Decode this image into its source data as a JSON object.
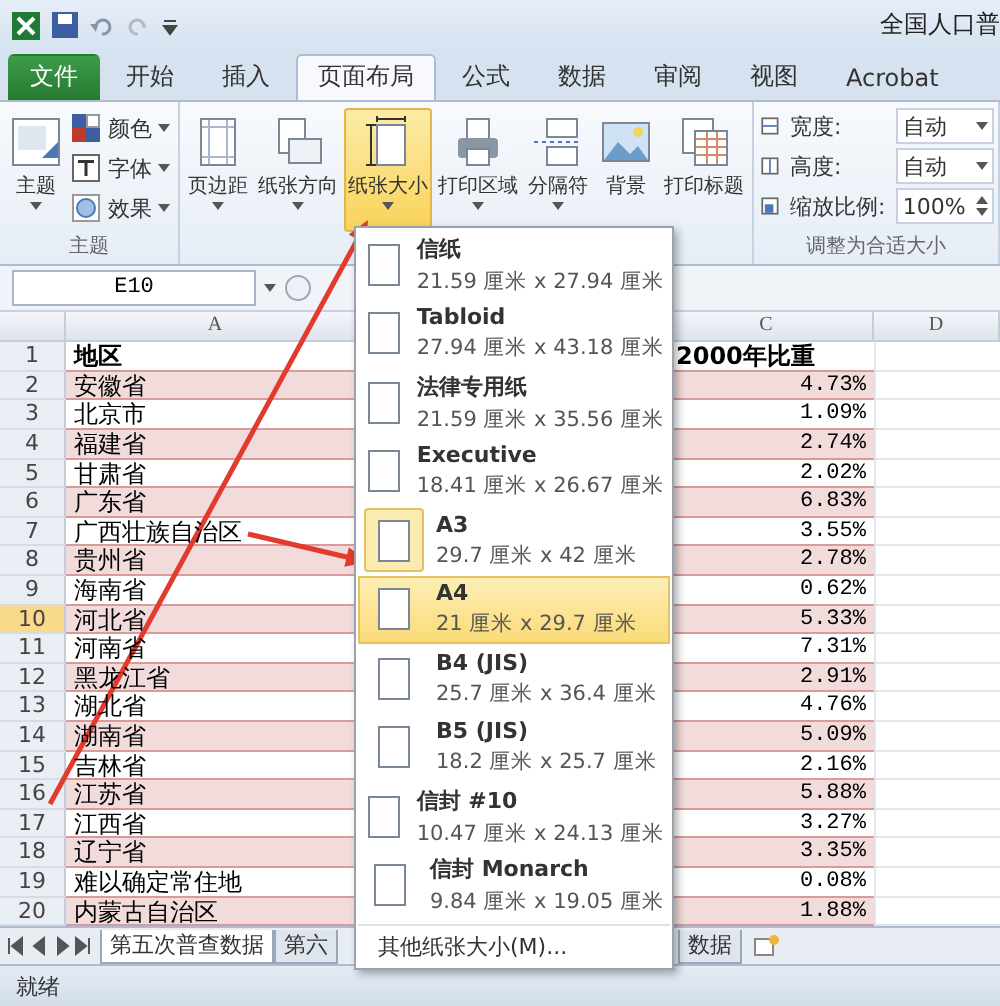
{
  "title_bar": {
    "title": "全国人口普"
  },
  "tabs": [
    {
      "label": "文件",
      "kind": "file",
      "selected": false
    },
    {
      "label": "开始",
      "kind": "tab",
      "selected": false
    },
    {
      "label": "插入",
      "kind": "tab",
      "selected": false
    },
    {
      "label": "页面布局",
      "kind": "tab",
      "selected": true
    },
    {
      "label": "公式",
      "kind": "tab",
      "selected": false
    },
    {
      "label": "数据",
      "kind": "tab",
      "selected": false
    },
    {
      "label": "审阅",
      "kind": "tab",
      "selected": false
    },
    {
      "label": "视图",
      "kind": "tab",
      "selected": false
    },
    {
      "label": "Acrobat",
      "kind": "tab",
      "selected": false
    }
  ],
  "ribbon": {
    "theme_group": {
      "label": "主题",
      "main": "主题",
      "items": [
        "颜色",
        "字体",
        "效果"
      ]
    },
    "page_setup": {
      "buttons": [
        {
          "label": "页边距",
          "caret": true,
          "highlighted": false
        },
        {
          "label": "纸张方向",
          "caret": true,
          "highlighted": false
        },
        {
          "label": "纸张大小",
          "caret": true,
          "highlighted": true
        },
        {
          "label": "打印区域",
          "caret": true,
          "highlighted": false
        },
        {
          "label": "分隔符",
          "caret": true,
          "highlighted": false
        },
        {
          "label": "背景",
          "caret": false,
          "highlighted": false
        },
        {
          "label": "打印标题",
          "caret": false,
          "highlighted": false
        }
      ]
    },
    "scale_group": {
      "label": "调整为合适大小",
      "fields": [
        {
          "label": "宽度:",
          "value": "自动",
          "kind": "dropdown"
        },
        {
          "label": "高度:",
          "value": "自动",
          "kind": "dropdown"
        },
        {
          "label": "缩放比例:",
          "value": "100%",
          "kind": "spinner"
        }
      ]
    }
  },
  "name_box": "E10",
  "columns": [
    {
      "label": "A",
      "selected": false
    },
    {
      "label": "C",
      "selected": false
    },
    {
      "label": "D",
      "selected": false
    }
  ],
  "header_row": {
    "number": "1",
    "region": "地区",
    "share": "2000年比重"
  },
  "rows": [
    {
      "number": "2",
      "region": "安徽省",
      "share": "4.73%",
      "shaded": true,
      "selected": false
    },
    {
      "number": "3",
      "region": "北京市",
      "share": "1.09%",
      "shaded": false,
      "selected": false
    },
    {
      "number": "4",
      "region": "福建省",
      "share": "2.74%",
      "shaded": true,
      "selected": false
    },
    {
      "number": "5",
      "region": "甘肃省",
      "share": "2.02%",
      "shaded": false,
      "selected": false
    },
    {
      "number": "6",
      "region": "广东省",
      "share": "6.83%",
      "shaded": true,
      "selected": false
    },
    {
      "number": "7",
      "region": "广西壮族自治区",
      "share": "3.55%",
      "shaded": false,
      "selected": false
    },
    {
      "number": "8",
      "region": "贵州省",
      "share": "2.78%",
      "shaded": true,
      "selected": false
    },
    {
      "number": "9",
      "region": "海南省",
      "share": "0.62%",
      "shaded": false,
      "selected": false
    },
    {
      "number": "10",
      "region": "河北省",
      "share": "5.33%",
      "shaded": true,
      "selected": true
    },
    {
      "number": "11",
      "region": "河南省",
      "share": "7.31%",
      "shaded": false,
      "selected": false
    },
    {
      "number": "12",
      "region": "黑龙江省",
      "share": "2.91%",
      "shaded": true,
      "selected": false
    },
    {
      "number": "13",
      "region": "湖北省",
      "share": "4.76%",
      "shaded": false,
      "selected": false
    },
    {
      "number": "14",
      "region": "湖南省",
      "share": "5.09%",
      "shaded": true,
      "selected": false
    },
    {
      "number": "15",
      "region": "吉林省",
      "share": "2.16%",
      "shaded": false,
      "selected": false
    },
    {
      "number": "16",
      "region": "江苏省",
      "share": "5.88%",
      "shaded": true,
      "selected": false
    },
    {
      "number": "17",
      "region": "江西省",
      "share": "3.27%",
      "shaded": false,
      "selected": false
    },
    {
      "number": "18",
      "region": "辽宁省",
      "share": "3.35%",
      "shaded": true,
      "selected": false
    },
    {
      "number": "19",
      "region": "难以确定常住地",
      "share": "0.08%",
      "shaded": false,
      "selected": false
    },
    {
      "number": "20",
      "region": "内蒙古自治区",
      "share": "1.88%",
      "shaded": true,
      "selected": false
    }
  ],
  "sheet_tabs": [
    {
      "label": "第五次普查数据",
      "selected": true
    },
    {
      "label": "第六",
      "selected": false
    },
    {
      "label": "数据",
      "selected": false
    }
  ],
  "status": "就绪",
  "paper_menu": {
    "items": [
      {
        "name": "信纸",
        "size": "21.59 厘米 x 27.94 厘米",
        "highlighted": false,
        "current": false
      },
      {
        "name": "Tabloid",
        "size": "27.94 厘米 x 43.18 厘米",
        "highlighted": false,
        "current": false
      },
      {
        "name": "法律专用纸",
        "size": "21.59 厘米 x 35.56 厘米",
        "highlighted": false,
        "current": false
      },
      {
        "name": "Executive",
        "size": "18.41 厘米 x 26.67 厘米",
        "highlighted": false,
        "current": false
      },
      {
        "name": "A3",
        "size": "29.7 厘米 x 42 厘米",
        "highlighted": false,
        "current": true
      },
      {
        "name": "A4",
        "size": "21 厘米 x 29.7 厘米",
        "highlighted": true,
        "current": false
      },
      {
        "name": "B4 (JIS)",
        "size": "25.7 厘米 x 36.4 厘米",
        "highlighted": false,
        "current": false
      },
      {
        "name": "B5 (JIS)",
        "size": "18.2 厘米 x 25.7 厘米",
        "highlighted": false,
        "current": false
      },
      {
        "name": "信封 #10",
        "size": "10.47 厘米 x 24.13 厘米",
        "highlighted": false,
        "current": false
      },
      {
        "name": "信封 Monarch",
        "size": "9.84 厘米 x 19.05 厘米",
        "highlighted": false,
        "current": false
      }
    ],
    "more": "其他纸张大小(M)..."
  }
}
